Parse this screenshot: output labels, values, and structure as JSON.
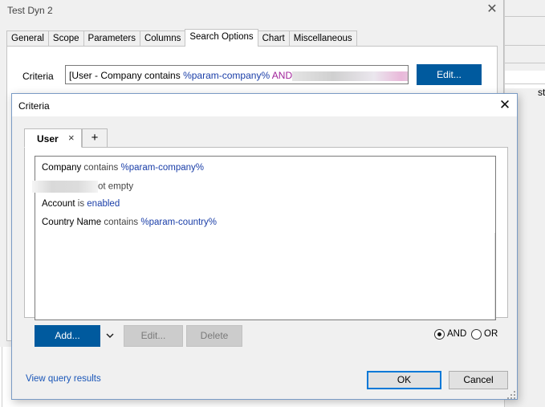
{
  "parent_window": {
    "title": "Test Dyn 2",
    "tabs": [
      "General",
      "Scope",
      "Parameters",
      "Columns",
      "Search Options",
      "Chart",
      "Miscellaneous"
    ],
    "active_tab": "Search Options",
    "criteria_label": "Criteria",
    "criteria_value": {
      "prefix": "[User",
      "dash": " - ",
      "field": "Company",
      "operator": " contains ",
      "param": "%param-company%",
      "conjunction": " AND"
    },
    "edit_button": "Edit..."
  },
  "background_window": {
    "visible_text": "st"
  },
  "criteria_dialog": {
    "title": "Criteria",
    "tabs": [
      {
        "label": "User",
        "closable": true
      }
    ],
    "add_tab_label": "+",
    "close_tab_glyph": "×",
    "conditions": [
      {
        "field": "Company",
        "operator": "contains",
        "value": "%param-company%"
      },
      {
        "field": "",
        "operator": "ot empty",
        "value": ""
      },
      {
        "field": "Account",
        "operator": "is",
        "value": "enabled"
      },
      {
        "field": "Country Name",
        "operator": "contains",
        "value": "%param-country%"
      }
    ],
    "buttons": {
      "add": "Add...",
      "edit": "Edit...",
      "delete": "Delete",
      "ok": "OK",
      "cancel": "Cancel"
    },
    "logic": {
      "options": [
        "AND",
        "OR"
      ],
      "selected": "AND"
    },
    "view_link": "View query results"
  },
  "colors": {
    "accent_blue": "#005a9e",
    "link_blue": "#1a56b8",
    "value_blue": "#1a3ea8",
    "conjunction_magenta": "#a0229a",
    "focus_border": "#0078d7"
  }
}
